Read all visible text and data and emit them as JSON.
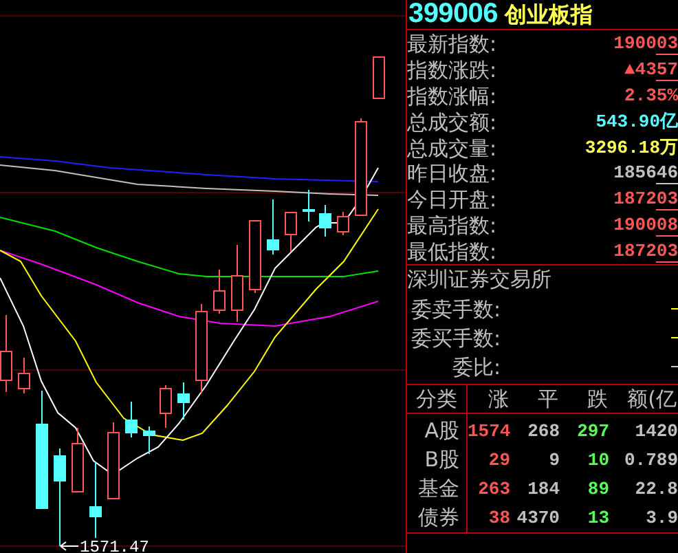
{
  "chart": {
    "low_label": "1571.47"
  },
  "quote": {
    "code": "399006",
    "name": "创业板指",
    "stats": [
      {
        "label": "最新指数:",
        "value": "1900",
        "value_underlined": "03",
        "color": "#ff5555"
      },
      {
        "label": "指数涨跌:",
        "value": "▲43",
        "value_underlined": "57",
        "color": "#ff5555"
      },
      {
        "label": "指数涨幅:",
        "value": "2.35%",
        "color": "#ff5555"
      },
      {
        "label": "总成交额:",
        "value": "543.90亿",
        "color": "#55ffff"
      },
      {
        "label": "总成交量:",
        "value": "3296.18万",
        "color": "#ffff55"
      },
      {
        "label": "昨日收盘:",
        "value": "1856",
        "value_underlined": "46",
        "color": "#c0c0c0"
      },
      {
        "label": "今日开盘:",
        "value": "1872",
        "value_underlined": "03",
        "color": "#ff5555"
      },
      {
        "label": "最高指数:",
        "value": "1900",
        "value_underlined": "08",
        "color": "#ff5555"
      },
      {
        "label": "最低指数:",
        "value": "1872",
        "value_underlined": "03",
        "color": "#ff5555"
      }
    ]
  },
  "exchange": {
    "title": "深圳证券交易所",
    "rows": [
      {
        "label": "委卖手数:",
        "color": "#ffff00"
      },
      {
        "label": "委买手数:",
        "color": "#ffff00"
      },
      {
        "label": "委比:",
        "color": "#c0c0c0"
      }
    ]
  },
  "breadth": {
    "columns": [
      "分类",
      "涨",
      "平",
      "跌",
      "额(亿"
    ],
    "rows": [
      {
        "category": "A股",
        "up": "1574",
        "flat": "268",
        "down": "297",
        "amount": "1420"
      },
      {
        "category": "B股",
        "up": "29",
        "flat": "9",
        "down": "10",
        "amount": "0.789"
      },
      {
        "category": "基金",
        "up": "263",
        "flat": "184",
        "down": "89",
        "amount": "22.8"
      },
      {
        "category": "债券",
        "up": "38",
        "flat": "4370",
        "down": "13",
        "amount": "3.9"
      }
    ]
  }
}
